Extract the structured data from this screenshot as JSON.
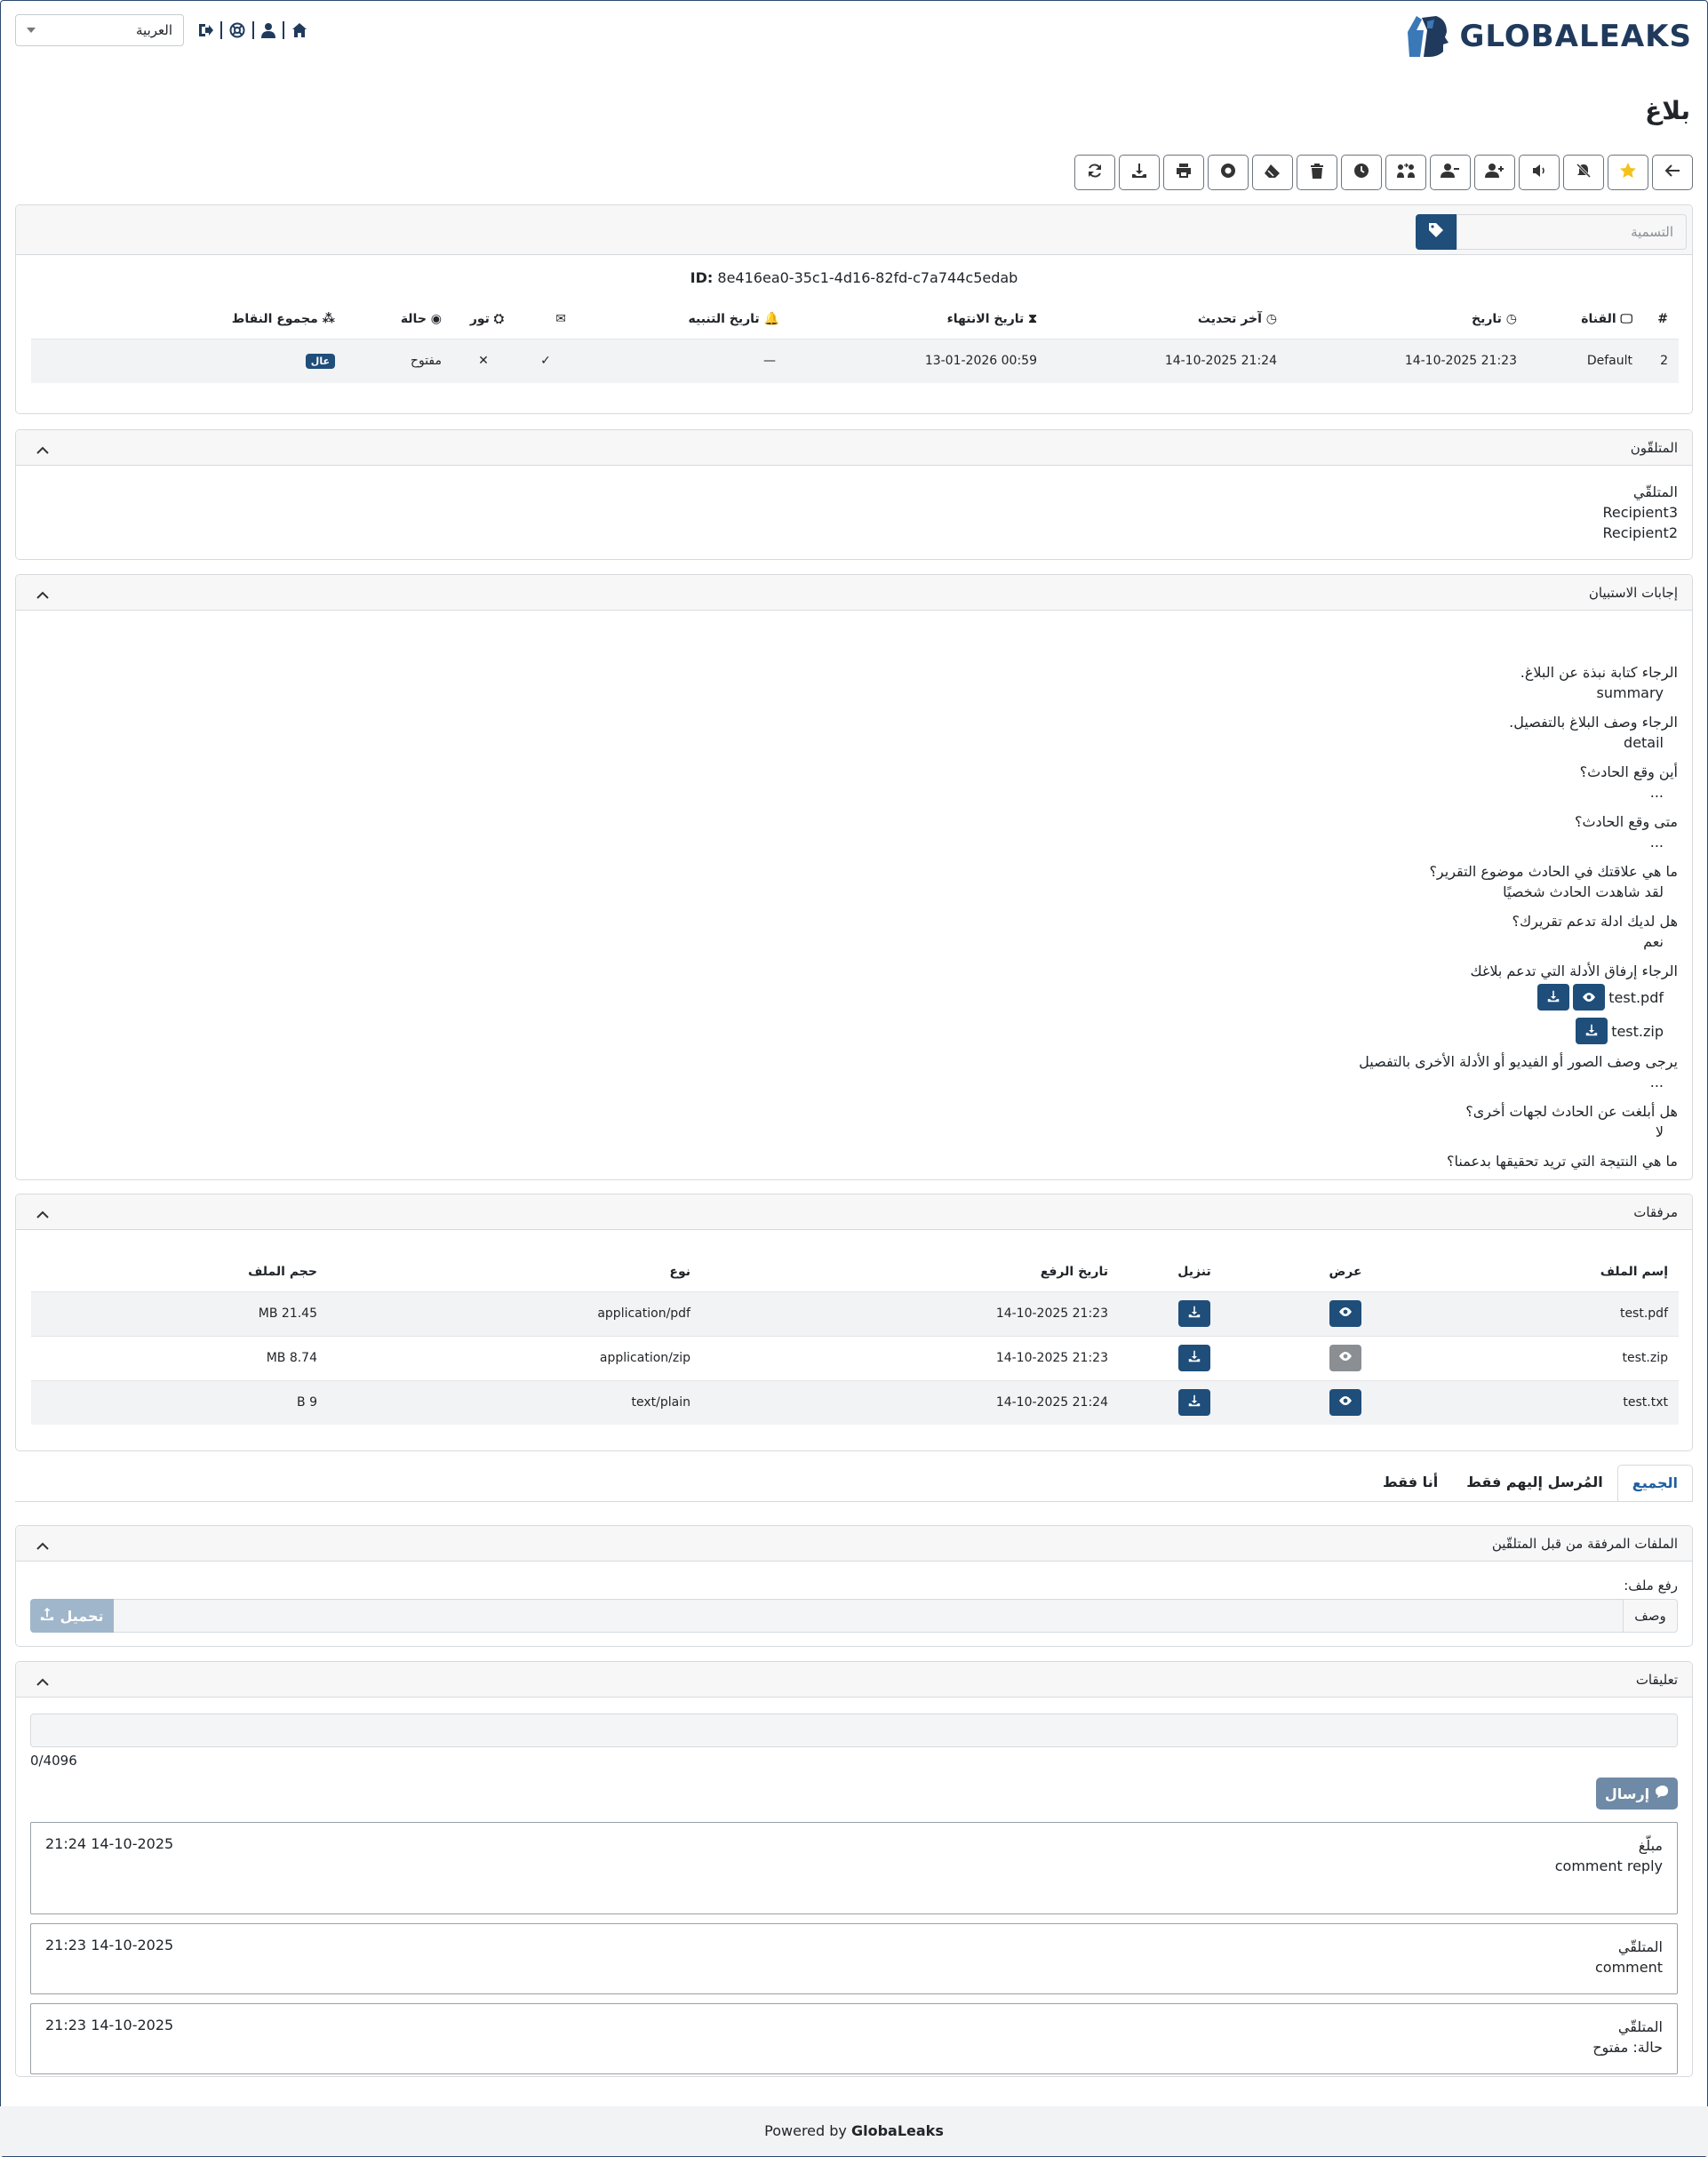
{
  "brand": {
    "name": "GLOBALEAKS",
    "color": "#1f3a5c",
    "accent": "#1f4e7a"
  },
  "header": {
    "language_selected": "العربية",
    "nav_icons": [
      "logout-icon",
      "support-icon",
      "user-icon",
      "home-icon"
    ]
  },
  "page_title": "بلاغ",
  "toolbar_icons": [
    "back-arrow-icon",
    "star-icon",
    "mute-icon",
    "volume-icon",
    "add-user-icon",
    "remove-user-icon",
    "transfer-icon",
    "clock-icon",
    "trash-icon",
    "eraser-icon",
    "record-icon",
    "print-icon",
    "download-icon",
    "refresh-icon"
  ],
  "labels": {
    "placeholder": "التسمية"
  },
  "report": {
    "id_label": "ID:",
    "id_value": "8e416ea0-35c1-4d16-82fd-c7a744c5edab",
    "headers": {
      "num": "#",
      "channel": "القناة",
      "date": "تاريخ",
      "updated": "آخر تحديث",
      "expiry": "تاريخ الانتهاء",
      "reminder": "تاريخ التنبيه",
      "tor": "تور",
      "status": "حالة",
      "score": "مجموع النقاط"
    },
    "row": {
      "num": "2",
      "channel": "Default",
      "date": "21:23 14-10-2025",
      "updated": "21:24 14-10-2025",
      "expiry": "00:59 13-01-2026",
      "reminder": "—",
      "read": "✓",
      "tor": "✕",
      "status": "مفتوح",
      "score": "عال"
    }
  },
  "recipients": {
    "title": "المتلقّون",
    "heading": "المتلقّي",
    "names": [
      "Recipient3",
      "Recipient2"
    ]
  },
  "answers": {
    "title": "إجابات الاستبيان",
    "items": [
      {
        "q": "الرجاء كتابة نبذة عن البلاغ.",
        "a": "summary"
      },
      {
        "q": "الرجاء وصف البلاغ بالتفصيل.",
        "a": "detail"
      },
      {
        "q": "أين وقع الحادث؟",
        "a": "..."
      },
      {
        "q": "متى وقع الحادث؟",
        "a": "..."
      },
      {
        "q": "ما هي علاقتك في الحادث موضوع التقرير؟",
        "a": "لقد شاهدت الحادث شخصيًا"
      },
      {
        "q": "هل لديك ادلة تدعم تقريرك؟",
        "a": "نعم"
      },
      {
        "q": "الرجاء إرفاق الأدلة التي تدعم بلاغك",
        "files": [
          "test.pdf",
          "test.zip"
        ]
      },
      {
        "q": "يرجى وصف الصور أو الفيديو أو الأدلة الأخرى بالتفصيل",
        "a": "..."
      },
      {
        "q": "هل أبلغت عن الحادث لجهات أخرى؟",
        "a": "لا"
      },
      {
        "q": "ما هي النتيجة التي تريد تحقيقها بدعمنا؟",
        "a": "..."
      }
    ]
  },
  "attachments": {
    "title": "مرفقات",
    "headers": {
      "name": "إسم الملف",
      "view": "عرض",
      "download": "تنزيل",
      "uploaded": "تاريخ الرفع",
      "type": "نوع",
      "size": "حجم الملف"
    },
    "rows": [
      {
        "name": "test.pdf",
        "uploaded": "21:23 14-10-2025",
        "type": "application/pdf",
        "size": "MB 21.45"
      },
      {
        "name": "test.zip",
        "uploaded": "21:23 14-10-2025",
        "type": "application/zip",
        "size": "MB 8.74"
      },
      {
        "name": "test.txt",
        "uploaded": "21:24 14-10-2025",
        "type": "text/plain",
        "size": "B 9"
      }
    ]
  },
  "tabs": [
    {
      "label": "الجميع"
    },
    {
      "label": "المُرسل إليهم فقط"
    },
    {
      "label": "أنا فقط"
    }
  ],
  "recipient_files": {
    "title": "الملفات المرفقة من قبل المتلقّين",
    "upload_label": "رفع ملف:",
    "desc_label": "وصف",
    "upload_button": "تحميل"
  },
  "comments": {
    "title": "تعليقات",
    "counter": "0/4096",
    "send_button": "إرسال",
    "items": [
      {
        "author": "مبلّغ",
        "text": "comment reply",
        "time": "21:24 14-10-2025"
      },
      {
        "author": "المتلقّي",
        "text": "comment",
        "time": "21:23 14-10-2025"
      },
      {
        "author": "المتلقّي",
        "text": "حالة: مفتوح",
        "time": "21:23 14-10-2025"
      }
    ]
  },
  "footer": {
    "prefix": "Powered by",
    "brand": "GlobaLeaks"
  }
}
